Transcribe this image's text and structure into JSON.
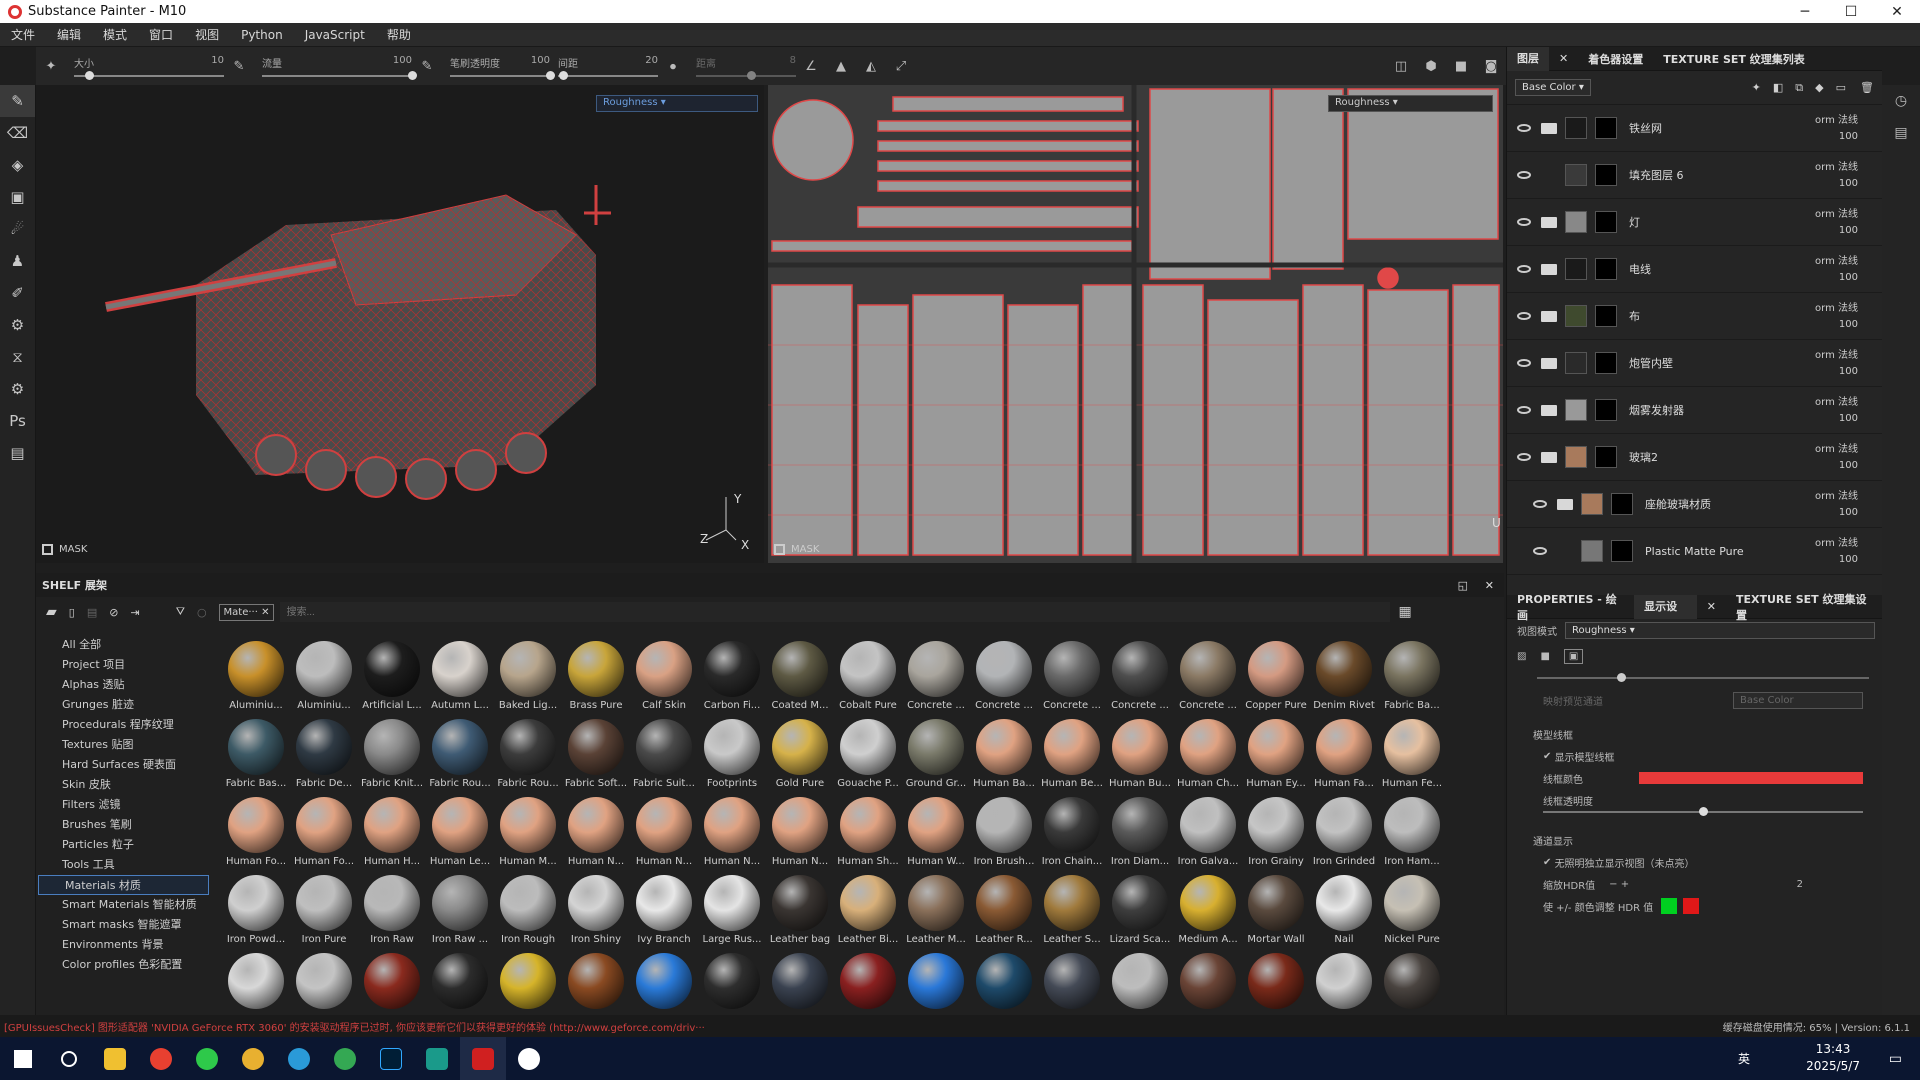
{
  "window": {
    "title": "Substance Painter - M10",
    "min": "─",
    "max": "☐",
    "close": "✕"
  },
  "menu": [
    "文件",
    "编辑",
    "模式",
    "窗口",
    "视图",
    "Python",
    "JavaScript",
    "帮助"
  ],
  "toolbar": {
    "size_label": "大小",
    "size_value": "10",
    "size_level": 0.1,
    "flow_label": "流量",
    "flow_value": "100",
    "flow_level": 1,
    "stroke_opacity_label": "笔刷透明度",
    "stroke_opacity_value": "100",
    "stroke_opacity_level": 1,
    "spacing_label": "间距",
    "spacing_value": "20",
    "spacing_level": 0.05,
    "jitter_label": "距离",
    "jitter_value": "8",
    "jitter_level": 0.55
  },
  "viewport3d": {
    "channel": "Roughness",
    "mask_label": "MASK",
    "axis_y": "Y",
    "axis_z": "Z",
    "axis_x": "X"
  },
  "viewport2d": {
    "channel": "Roughness",
    "mask_label": "MASK",
    "axis_u": "U"
  },
  "right_tabs": {
    "layers": "图层",
    "shaders": "着色器设置",
    "texture_sets": "TEXTURE SET 纹理集列表"
  },
  "layer_channel": "Base Color",
  "layers": [
    {
      "name": "铁丝网",
      "blend": "orm 法线",
      "opacity": "100",
      "thumb": "#1a1a1a",
      "type": "folder"
    },
    {
      "name": "填充图层 6",
      "blend": "orm 法线",
      "opacity": "100",
      "thumb": "#3a3a3a",
      "type": "fill"
    },
    {
      "name": "灯",
      "blend": "orm 法线",
      "opacity": "100",
      "thumb": "#888",
      "type": "folder"
    },
    {
      "name": "电线",
      "blend": "orm 法线",
      "opacity": "100",
      "thumb": "#1a1a1a",
      "type": "folder"
    },
    {
      "name": "布",
      "blend": "orm 法线",
      "opacity": "100",
      "thumb": "#3f4a2e",
      "type": "folder"
    },
    {
      "name": "炮管内壁",
      "blend": "orm 法线",
      "opacity": "100",
      "thumb": "#2a2a2a",
      "type": "folder"
    },
    {
      "name": "烟雾发射器",
      "blend": "orm 法线",
      "opacity": "100",
      "thumb": "#999",
      "type": "folder"
    },
    {
      "name": "玻璃2",
      "blend": "orm 法线",
      "opacity": "100",
      "thumb": "#a87a5c",
      "type": "folder"
    },
    {
      "name": "座舱玻璃材质",
      "blend": "orm 法线",
      "opacity": "100",
      "thumb": "#a87a5c",
      "type": "folder"
    },
    {
      "name": "Plastic Matte Pure",
      "blend": "orm 法线",
      "opacity": "100",
      "thumb": "#777",
      "type": "fill"
    }
  ],
  "props_tabs": {
    "properties": "PROPERTIES - 绘画",
    "display": "显示设置",
    "texture_set": "TEXTURE SET 纹理集设置"
  },
  "props": {
    "view_mode_label": "视图模式",
    "view_mode_value": "Roughness",
    "map_channel_label": "映射预览通道",
    "map_channel_value": "Base Color",
    "wire_section": "模型线框",
    "show_wire": "显示模型线框",
    "wire_color_label": "线框颜色",
    "wire_color": "#e83a3a",
    "wire_opacity_label": "线框透明度",
    "wire_opacity_level": 0.5,
    "channel_section": "通道显示",
    "isolate_label": "无照明独立显示视图（未点亮）",
    "hdr_label": "缩放HDR值",
    "hdr_value": "2",
    "color_adjust_label": "使 +/- 颜色调整 HDR 值"
  },
  "shelf": {
    "title": "SHELF 展架",
    "filter_tag": "Mate···",
    "search_placeholder": "搜索..."
  },
  "categories": [
    "All 全部",
    "Project 项目",
    "Alphas 透贴",
    "Grunges 脏迹",
    "Procedurals 程序纹理",
    "Textures 贴图",
    "Hard Surfaces 硬表面",
    "Skin 皮肤",
    "Filters 滤镜",
    "Brushes 笔刷",
    "Particles 粒子",
    "Tools 工具",
    "Materials 材质",
    "Smart Materials 智能材质",
    "Smart masks 智能遮罩",
    "Environments 背景",
    "Color profiles 色彩配置"
  ],
  "active_category": "Materials 材质",
  "materials": [
    {
      "n": "Aluminiu...",
      "c": "#c8902a"
    },
    {
      "n": "Aluminiu...",
      "c": "#bdbdbd"
    },
    {
      "n": "Artificial L...",
      "c": "#1d1d1d"
    },
    {
      "n": "Autumn L...",
      "c": "#d8d2cc"
    },
    {
      "n": "Baked Lig...",
      "c": "#b7a58c"
    },
    {
      "n": "Brass Pure",
      "c": "#c8a53a"
    },
    {
      "n": "Calf Skin",
      "c": "#d9a184"
    },
    {
      "n": "Carbon Fi...",
      "c": "#2a2a2a"
    },
    {
      "n": "Coated M...",
      "c": "#5e5a44"
    },
    {
      "n": "Cobalt Pure",
      "c": "#c4c4c4"
    },
    {
      "n": "Concrete ...",
      "c": "#a9a59d"
    },
    {
      "n": "Concrete ...",
      "c": "#b2b4b6"
    },
    {
      "n": "Concrete ...",
      "c": "#6a6a6a"
    },
    {
      "n": "Concrete ...",
      "c": "#4e4e4e"
    },
    {
      "n": "Concrete ...",
      "c": "#8b7a65"
    },
    {
      "n": "Copper Pure",
      "c": "#d49a82"
    },
    {
      "n": "Denim Rivet",
      "c": "#6a4a2a"
    },
    {
      "n": "Fabric Ba...",
      "c": "#7a7460"
    },
    {
      "n": "Fabric Bas...",
      "c": "#3d5a66"
    },
    {
      "n": "Fabric De...",
      "c": "#2f3a44"
    },
    {
      "n": "Fabric Knit...",
      "c": "#8a8a8a"
    },
    {
      "n": "Fabric Rou...",
      "c": "#3f5b74"
    },
    {
      "n": "Fabric Rou...",
      "c": "#3c3c3c"
    },
    {
      "n": "Fabric Soft...",
      "c": "#5a4236"
    },
    {
      "n": "Fabric Suit...",
      "c": "#4a4a4a"
    },
    {
      "n": "Footprints",
      "c": "#c9c9c9"
    },
    {
      "n": "Gold Pure",
      "c": "#d6b24a"
    },
    {
      "n": "Gouache P...",
      "c": "#cfcfcf"
    },
    {
      "n": "Ground Gr...",
      "c": "#7a7a6a"
    },
    {
      "n": "Human Ba...",
      "c": "#e0a282"
    },
    {
      "n": "Human Be...",
      "c": "#e0a282"
    },
    {
      "n": "Human Bu...",
      "c": "#e0a282"
    },
    {
      "n": "Human Ch...",
      "c": "#e0a282"
    },
    {
      "n": "Human Ey...",
      "c": "#e0a282"
    },
    {
      "n": "Human Fa...",
      "c": "#e0a282"
    },
    {
      "n": "Human Fe...",
      "c": "#e6c0a0"
    },
    {
      "n": "Human Fo...",
      "c": "#e0a282"
    },
    {
      "n": "Human Fo...",
      "c": "#e0a282"
    },
    {
      "n": "Human H...",
      "c": "#e0a282"
    },
    {
      "n": "Human Le...",
      "c": "#e0a282"
    },
    {
      "n": "Human M...",
      "c": "#e0a282"
    },
    {
      "n": "Human N...",
      "c": "#e0a282"
    },
    {
      "n": "Human N...",
      "c": "#e0a282"
    },
    {
      "n": "Human N...",
      "c": "#e0a282"
    },
    {
      "n": "Human N...",
      "c": "#e0a282"
    },
    {
      "n": "Human Sh...",
      "c": "#e0a282"
    },
    {
      "n": "Human W...",
      "c": "#e0a282"
    },
    {
      "n": "Iron Brush...",
      "c": "#b5b5b5"
    },
    {
      "n": "Iron Chain...",
      "c": "#3a3a3a"
    },
    {
      "n": "Iron Diam...",
      "c": "#5a5a5a"
    },
    {
      "n": "Iron Galva...",
      "c": "#c0c0c0"
    },
    {
      "n": "Iron Grainy",
      "c": "#c6c6c6"
    },
    {
      "n": "Iron Grinded",
      "c": "#c2c2c2"
    },
    {
      "n": "Iron Ham...",
      "c": "#bdbdbd"
    },
    {
      "n": "Iron Powd...",
      "c": "#cfcfcf"
    },
    {
      "n": "Iron Pure",
      "c": "#bfbfbf"
    },
    {
      "n": "Iron Raw",
      "c": "#b8b8b8"
    },
    {
      "n": "Iron Raw ...",
      "c": "#8a8a8a"
    },
    {
      "n": "Iron Rough",
      "c": "#bcbcbc"
    },
    {
      "n": "Iron Shiny",
      "c": "#d4d4d4"
    },
    {
      "n": "Ivy Branch",
      "c": "#e8e8e8"
    },
    {
      "n": "Large Rus...",
      "c": "#e4e4e4"
    },
    {
      "n": "Leather bag",
      "c": "#3a3532"
    },
    {
      "n": "Leather Bi...",
      "c": "#d8b07a"
    },
    {
      "n": "Leather M...",
      "c": "#8a705a"
    },
    {
      "n": "Leather R...",
      "c": "#8a5a34"
    },
    {
      "n": "Leather S...",
      "c": "#a07a3c"
    },
    {
      "n": "Lizard Sca...",
      "c": "#3e3e3e"
    },
    {
      "n": "Medium A...",
      "c": "#d8b030"
    },
    {
      "n": "Mortar Wall",
      "c": "#5a4a3e"
    },
    {
      "n": "Nail",
      "c": "#e8e8e8"
    },
    {
      "n": "Nickel Pure",
      "c": "#c6c0b4"
    },
    {
      "n": "",
      "c": "#d8d8d8"
    },
    {
      "n": "",
      "c": "#c4c4c4"
    },
    {
      "n": "",
      "c": "#8a2a1e"
    },
    {
      "n": "",
      "c": "#2c2c2c"
    },
    {
      "n": "",
      "c": "#d6b42a"
    },
    {
      "n": "",
      "c": "#8a4a22"
    },
    {
      "n": "",
      "c": "#2a7ad8"
    },
    {
      "n": "",
      "c": "#2e2e2e"
    },
    {
      "n": "",
      "c": "#3a4250"
    },
    {
      "n": "",
      "c": "#8a2020"
    },
    {
      "n": "",
      "c": "#2a78d8"
    },
    {
      "n": "",
      "c": "#1e4a6a"
    },
    {
      "n": "",
      "c": "#444a56"
    },
    {
      "n": "",
      "c": "#bdbdbd"
    },
    {
      "n": "",
      "c": "#6a4436"
    },
    {
      "n": "",
      "c": "#7a2a1a"
    },
    {
      "n": "",
      "c": "#d0d0d0"
    },
    {
      "n": "",
      "c": "#4a4440"
    }
  ],
  "status": {
    "message": "[GPUIssuesCheck] 图形适配器 'NVIDIA GeForce RTX 3060' 的安装驱动程序已过时, 你应该更新它们以获得更好的体验 (http://www.geforce.com/driv···",
    "cache": "缓存磁盘使用情况: 65%",
    "version": "Version: 6.1.1"
  },
  "taskbar": {
    "time": "13:43",
    "date": "2025/5/7",
    "lang": "英"
  }
}
